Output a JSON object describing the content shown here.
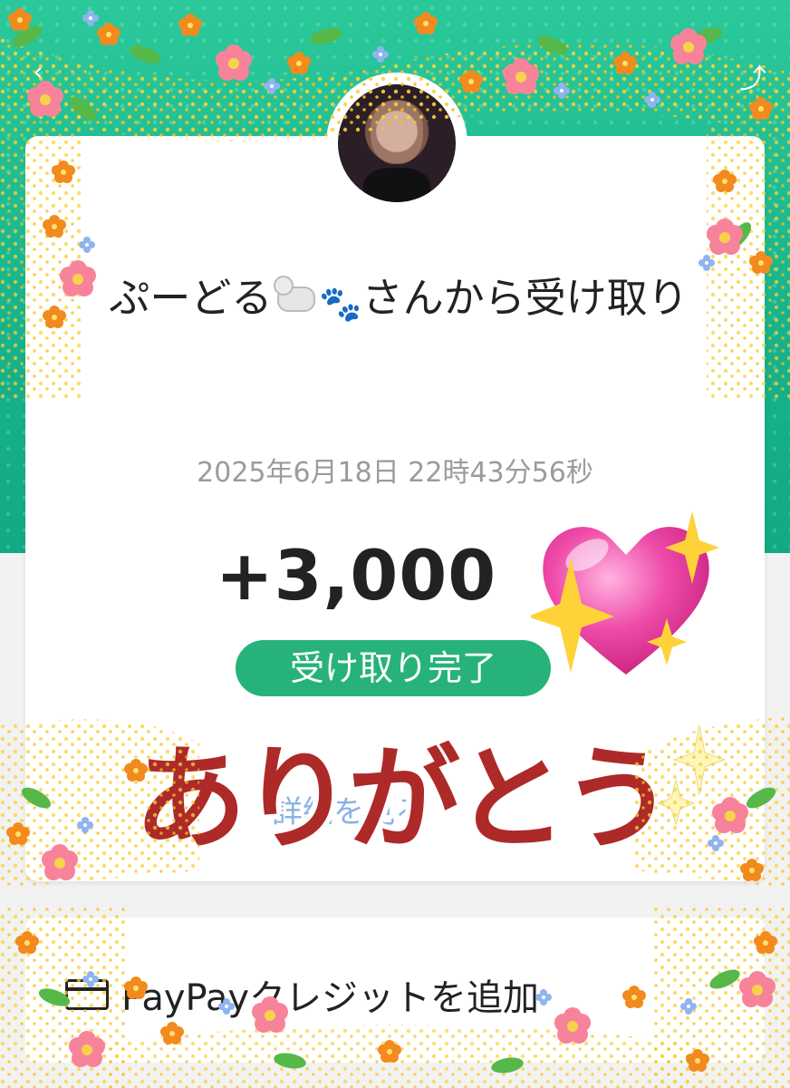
{
  "header": {
    "back_icon": "chevron-left-icon",
    "share_icon": "share-icon"
  },
  "transfer": {
    "title": "ぷーどる🐩🐾さんから受け取り",
    "title_sender": "ぷーどる",
    "title_suffix": "さんから受け取り",
    "title_emoji_paws": "🐾",
    "timestamp": "2025年6月18日 22時43分56秒",
    "amount": "+3,000",
    "status": "受け取り完了",
    "link_text": "詳細を見る"
  },
  "sticker": {
    "text": "ありがとう",
    "heart_color": "#e8479e",
    "text_color": "#ad2a28"
  },
  "credit": {
    "label": "PayPayクレジットを追加"
  },
  "colors": {
    "accent": "#1cb98e",
    "status_green": "#27b27a"
  }
}
